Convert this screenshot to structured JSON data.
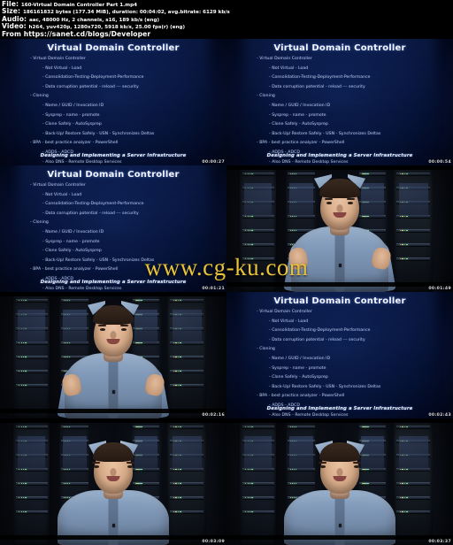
{
  "info": {
    "file_label": "File:",
    "file_value": "160-Virtual Domain Controller Part 1.mp4",
    "size_label": "Size:",
    "size_value": "186161832 bytes (177.34 MiB), duration: 00:04:02, avg.bitrate: 6129 kb/s",
    "audio_label": "Audio:",
    "audio_value": "aac, 48000 Hz, 2 channels, s16, 189 kb/s (eng)",
    "video_label": "Video:",
    "video_value": "h264, yuv420p, 1280x720, 5918 kb/s, 25.00 fps(r) (eng)",
    "from_label": "From",
    "from_value": "https://sanet.cd/blogs/Developer"
  },
  "watermark": "www.cg-ku.com",
  "slide": {
    "title": "Virtual Domain Controller",
    "footer": "Designing and Implementing a Server Infrastructure",
    "bullets": [
      {
        "level": 1,
        "text": "- Virtual Domain Controller"
      },
      {
        "level": 2,
        "text": "- Not Virtual  - Load"
      },
      {
        "level": 2,
        "text": "- Consolidation-Testing-Deployment-Performance"
      },
      {
        "level": 2,
        "text": "- Data corruption potential  -  reload  ---  security"
      },
      {
        "level": 1,
        "text": "- Cloning"
      },
      {
        "level": 2,
        "text": "- Name / GUID / Invocation ID"
      },
      {
        "level": 2,
        "text": "- Sysprep  -  name  -  promote"
      },
      {
        "level": 2,
        "text": "- Clone Safely  -  AutoSysprep"
      },
      {
        "level": 2,
        "text": "- Back-Up/ Restore Safely  -  USN  -  Synchronizes Deltas"
      },
      {
        "level": 1,
        "text": "- BPA  -  best practice analyzer  -  PowerShell"
      },
      {
        "level": 2,
        "text": "- ADDS  -  ADCD"
      },
      {
        "level": 2,
        "text": "- Also DNS  -  Remote Desktop Services"
      }
    ]
  },
  "thumbnails": [
    {
      "kind": "slide",
      "timestamp": "00:00:27"
    },
    {
      "kind": "slide",
      "timestamp": "00:00:54"
    },
    {
      "kind": "slide",
      "timestamp": "00:01:21"
    },
    {
      "kind": "video",
      "pose": "gesture",
      "timestamp": "00:01:49"
    },
    {
      "kind": "video",
      "pose": "gesture",
      "timestamp": "00:02:16"
    },
    {
      "kind": "slide",
      "timestamp": "00:02:43"
    },
    {
      "kind": "video",
      "pose": "sit",
      "timestamp": "00:03:09"
    },
    {
      "kind": "video",
      "pose": "sit",
      "timestamp": "00:03:37"
    }
  ]
}
